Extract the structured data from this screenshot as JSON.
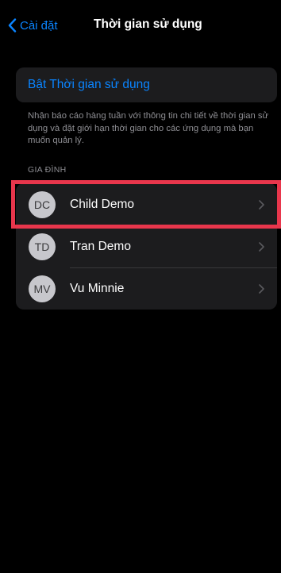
{
  "nav": {
    "back_label": "Cài đặt",
    "title": "Thời gian sử dụng"
  },
  "enable": {
    "label": "Bật Thời gian sử dụng"
  },
  "footnote": "Nhận báo cáo hàng tuần với thông tin chi tiết về thời gian sử dụng và đặt giới hạn thời gian cho các ứng dụng mà bạn muốn quản lý.",
  "family": {
    "header": "GIA ĐÌNH",
    "members": [
      {
        "initials": "DC",
        "name": "Child Demo"
      },
      {
        "initials": "TD",
        "name": "Tran Demo"
      },
      {
        "initials": "MV",
        "name": "Vu Minnie"
      }
    ]
  },
  "colors": {
    "accent": "#0a84ff",
    "background": "#000000",
    "card": "#1c1c1e",
    "secondary_text": "#8e8e93",
    "highlight": "#e8364c"
  }
}
